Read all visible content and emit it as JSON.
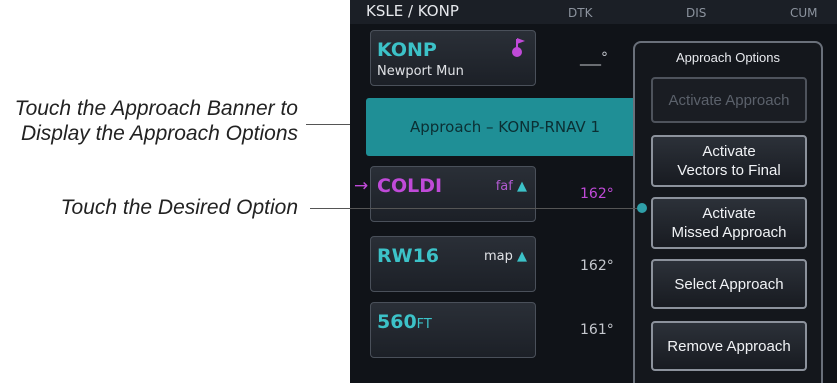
{
  "callouts": {
    "banner_line1": "Touch the Approach Banner to",
    "banner_line2": "Display the Approach Options",
    "option": "Touch the Desired Option"
  },
  "flight_plan": {
    "route": "KSLE / KONP",
    "columns": {
      "dtk": "DTK",
      "dis": "DIS",
      "cum": "CUM"
    },
    "destination": {
      "ident": "KONP",
      "name": "Newport Mun",
      "dtk": "___°"
    },
    "approach_banner": "Approach – KONP-RNAV 1",
    "waypoints": [
      {
        "ident": "COLDI",
        "leg": "faf",
        "dtk": "162°",
        "active": true
      },
      {
        "ident": "RW16",
        "leg": "map",
        "dtk": "162°",
        "active": false
      },
      {
        "ident": "560",
        "unit": "FT",
        "dtk": "161°",
        "active": false
      }
    ]
  },
  "approach_options": {
    "title": "Approach Options",
    "buttons": [
      {
        "label": "Activate Approach",
        "enabled": false
      },
      {
        "label_line1": "Activate",
        "label_line2": "Vectors to Final",
        "enabled": true
      },
      {
        "label_line1": "Activate",
        "label_line2": "Missed Approach",
        "enabled": true
      },
      {
        "label": "Select Approach",
        "enabled": true
      },
      {
        "label": "Remove Approach",
        "enabled": true
      }
    ]
  },
  "colors": {
    "accent_cyan": "#3cc2c8",
    "banner_teal": "#1f8f96",
    "magenta": "#c04ad8"
  }
}
